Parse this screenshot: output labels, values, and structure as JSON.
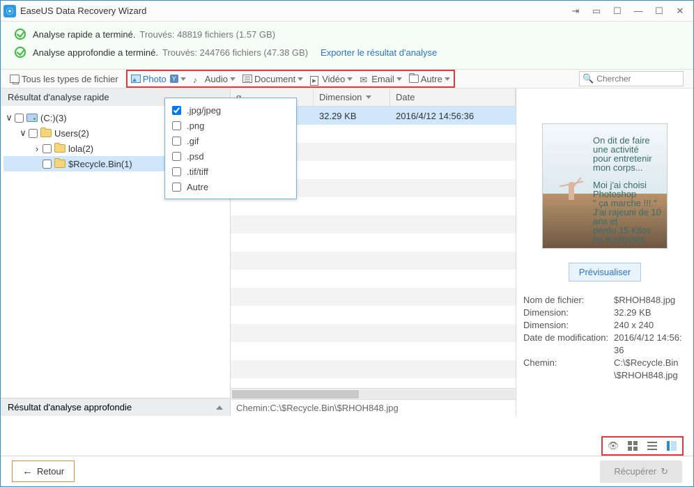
{
  "titlebar": {
    "app_title": "EaseUS Data Recovery Wizard"
  },
  "summary": {
    "quick": {
      "label": "Analyse rapide a terminé.",
      "found": "Trouvés: 48819 fichiers (1.57 GB)"
    },
    "deep": {
      "label": "Analyse approfondie a terminé.",
      "found": "Trouvés: 244766 fichiers (47.38 GB)"
    },
    "export_link": "Exporter le résultat d'analyse"
  },
  "typebar": {
    "all": "Tous les types de fichier",
    "photo": "Photo",
    "audio": "Audio",
    "document": "Document",
    "video": "Vidéo",
    "email": "Email",
    "autre": "Autre"
  },
  "photo_dropdown": {
    "items": [
      {
        "label": ".jpg/jpeg",
        "checked": true
      },
      {
        "label": ".png",
        "checked": false
      },
      {
        "label": ".gif",
        "checked": false
      },
      {
        "label": ".psd",
        "checked": false
      },
      {
        "label": ".tif/tiff",
        "checked": false
      },
      {
        "label": "Autre",
        "checked": false
      }
    ]
  },
  "search": {
    "placeholder": "Chercher"
  },
  "left": {
    "quick_header": "Résultat d'analyse rapide",
    "deep_header": "Résultat d'analyse approfondie",
    "tree": {
      "root": "(C:)(3)",
      "users": "Users(2)",
      "lola": "lola(2)",
      "recycle": "$Recycle.Bin(1)"
    }
  },
  "list": {
    "headers": {
      "name": "g",
      "dim": "Dimension",
      "date": "Date"
    },
    "row": {
      "dim": "32.29 KB",
      "date": "2016/4/12 14:56:36"
    },
    "path_prefix": "Chemin:",
    "path_value": "C:\\$Recycle.Bin\\$RHOH848.jpg"
  },
  "preview": {
    "caption_lines": [
      "On dit de faire une activité",
      "pour entretenir mon corps...",
      "",
      "Moi j'ai choisi Photoshop",
      "\" ça marche !!! \"",
      "J'ai rajeuni de 10 ans et",
      "perdu 15 Kilos en 8 minutes"
    ],
    "button": "Prévisualiser",
    "meta": {
      "k_name": "Nom de fichier:",
      "v_name": "$RHOH848.jpg",
      "k_dim": "Dimension:",
      "v_dim": "32.29 KB",
      "k_dim2": "Dimension:",
      "v_dim2": "240 x 240",
      "k_mod": "Date de modification:",
      "v_mod": "2016/4/12 14:56:36",
      "k_path": "Chemin:",
      "v_path": "C:\\$Recycle.Bin\\$RHOH848.jpg"
    }
  },
  "footer": {
    "back": "Retour",
    "recover": "Récupérer"
  }
}
